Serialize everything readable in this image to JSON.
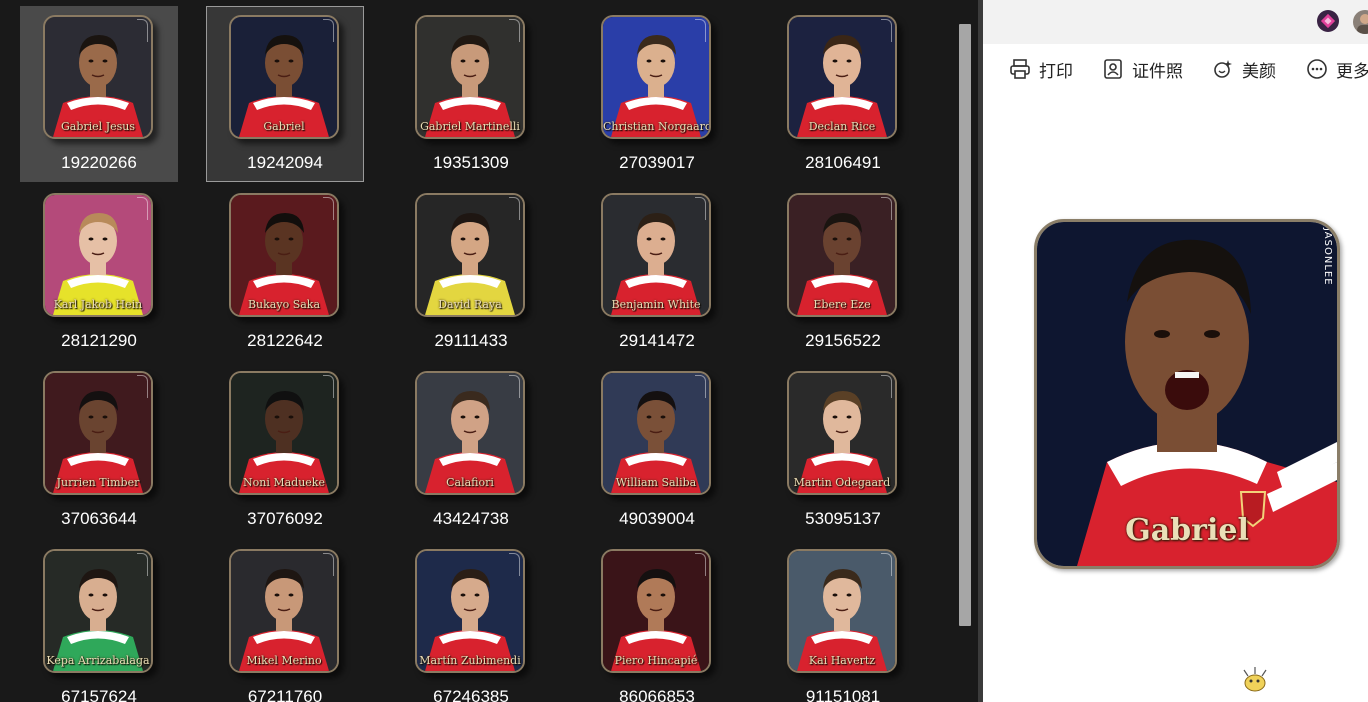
{
  "grid": {
    "tiles": [
      {
        "name": "Gabriel Jesus",
        "id": "19220266",
        "state": "hovered",
        "bg": "#2c2c34",
        "skin": "#9a6a4a",
        "hair": "#1a1410",
        "kit": "#d8222e"
      },
      {
        "name": "Gabriel",
        "id": "19242094",
        "state": "selected",
        "bg": "#1a2038",
        "skin": "#7a4e34",
        "hair": "#15110e",
        "kit": "#d8222e"
      },
      {
        "name": "Gabriel Martinelli",
        "id": "19351309",
        "state": "",
        "bg": "#30302e",
        "skin": "#c89a7a",
        "hair": "#201812",
        "kit": "#d8222e"
      },
      {
        "name": "Christian Norgaard",
        "id": "27039017",
        "state": "",
        "bg": "#2a3ea8",
        "skin": "#dbb08e",
        "hair": "#3a2a1c",
        "kit": "#d8222e"
      },
      {
        "name": "Declan Rice",
        "id": "28106491",
        "state": "",
        "bg": "#1c2240",
        "skin": "#e0b496",
        "hair": "#3a2616",
        "kit": "#d8222e"
      },
      {
        "name": "Karl Jakob Hein",
        "id": "28121290",
        "state": "",
        "bg": "#b44a7a",
        "skin": "#e6c0a6",
        "hair": "#b88a5a",
        "kit": "#e6e22a"
      },
      {
        "name": "Bukayo Saka",
        "id": "28122642",
        "state": "",
        "bg": "#5a1a1e",
        "skin": "#5a3422",
        "hair": "#120e0c",
        "kit": "#d8222e"
      },
      {
        "name": "David Raya",
        "id": "29111433",
        "state": "",
        "bg": "#262626",
        "skin": "#d4a684",
        "hair": "#1e1612",
        "kit": "#e3d640"
      },
      {
        "name": "Benjamin White",
        "id": "29141472",
        "state": "",
        "bg": "#2a2c30",
        "skin": "#dcae90",
        "hair": "#2c2016",
        "kit": "#d8222e"
      },
      {
        "name": "Ebere Eze",
        "id": "29156522",
        "state": "",
        "bg": "#3a2024",
        "skin": "#6a4230",
        "hair": "#1a1410",
        "kit": "#d8222e"
      },
      {
        "name": "Jurrien Timber",
        "id": "37063644",
        "state": "",
        "bg": "#401a1e",
        "skin": "#6a4430",
        "hair": "#141010",
        "kit": "#d8222e"
      },
      {
        "name": "Noni Madueke",
        "id": "37076092",
        "state": "",
        "bg": "#1e2420",
        "skin": "#4e3022",
        "hair": "#101010",
        "kit": "#d8222e"
      },
      {
        "name": "Calafiori",
        "id": "43424738",
        "state": "",
        "bg": "#383c44",
        "skin": "#d0a286",
        "hair": "#3a2a1e",
        "kit": "#d8222e"
      },
      {
        "name": "William Saliba",
        "id": "49039004",
        "state": "",
        "bg": "#303a56",
        "skin": "#7a5038",
        "hair": "#141010",
        "kit": "#d8222e"
      },
      {
        "name": "Martin Odegaard",
        "id": "53095137",
        "state": "",
        "bg": "#2a2a2a",
        "skin": "#e0b89c",
        "hair": "#5a4026",
        "kit": "#d8222e"
      },
      {
        "name": "Kepa Arrizabalaga",
        "id": "67157624",
        "state": "",
        "bg": "#262a26",
        "skin": "#d8ae90",
        "hair": "#1e1612",
        "kit": "#2fa85a"
      },
      {
        "name": "Mikel Merino",
        "id": "67211760",
        "state": "",
        "bg": "#2a2a2e",
        "skin": "#c89878",
        "hair": "#1e1612",
        "kit": "#d8222e"
      },
      {
        "name": "Martín Zubimendi",
        "id": "67246385",
        "state": "",
        "bg": "#1e2a4a",
        "skin": "#d6aa8c",
        "hair": "#2a1e16",
        "kit": "#d8222e"
      },
      {
        "name": "Piero Hincapié",
        "id": "86066853",
        "state": "",
        "bg": "#3a1418",
        "skin": "#b07a58",
        "hair": "#141010",
        "kit": "#d8222e"
      },
      {
        "name": "Kai Havertz",
        "id": "91151081",
        "state": "",
        "bg": "#4a5a6a",
        "skin": "#e0b89c",
        "hair": "#3a2a1c",
        "kit": "#d8222e"
      }
    ]
  },
  "viewer": {
    "toolbar": [
      {
        "label": "打印",
        "icon": "printer-icon"
      },
      {
        "label": "证件照",
        "icon": "id-photo-icon"
      },
      {
        "label": "美颜",
        "icon": "beauty-icon"
      },
      {
        "label": "更多",
        "icon": "more-icon"
      }
    ],
    "preview": {
      "name": "Gabriel",
      "watermark": "JASONLEE",
      "bg": "#0e1630",
      "skin": "#7a4e34",
      "hair": "#15110e",
      "kit": "#d8222e"
    }
  }
}
